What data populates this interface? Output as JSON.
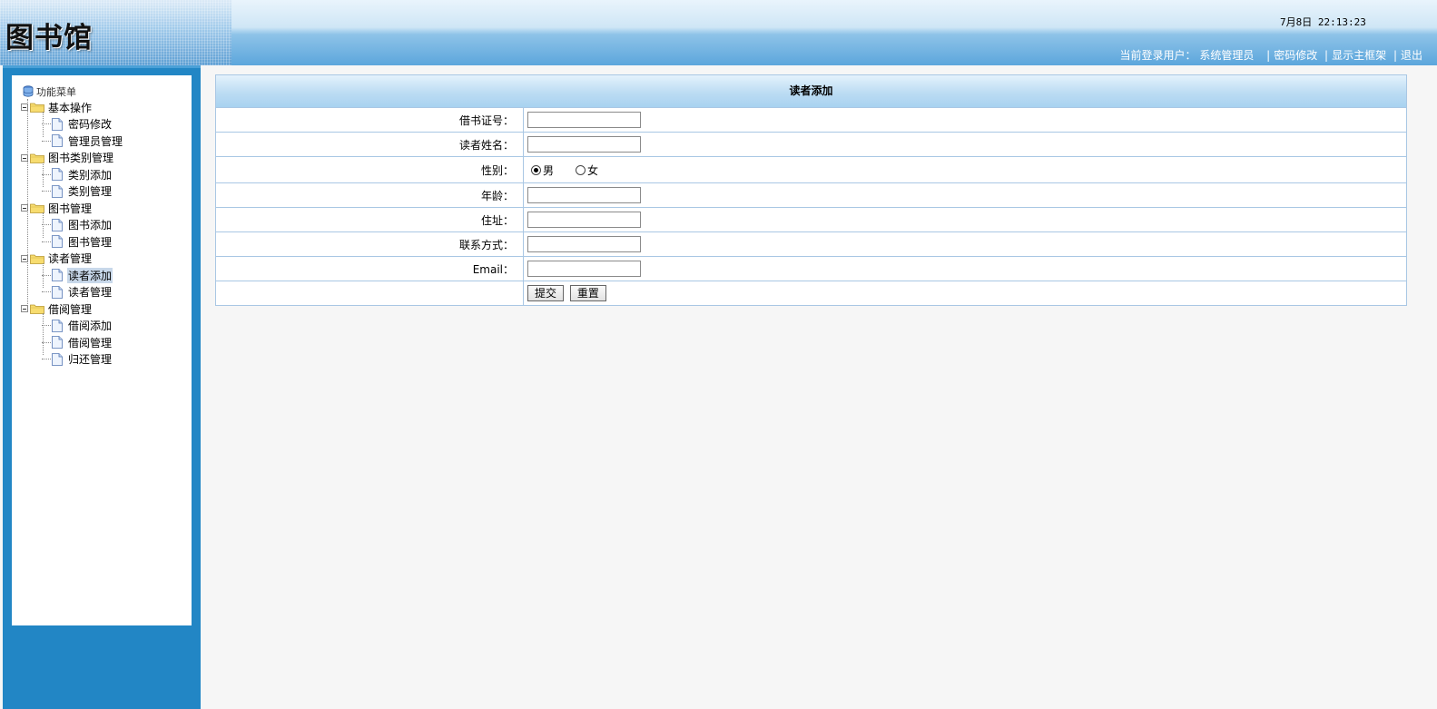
{
  "header": {
    "logo_title": "图书馆",
    "datetime": "7月8日 22:13:23",
    "user_label": "当前登录用户：",
    "user_name": "系统管理员",
    "links": [
      "密码修改",
      "显示主框架",
      "退出"
    ]
  },
  "menu": {
    "root_label": "功能菜单",
    "groups": [
      {
        "label": "基本操作",
        "items": [
          "密码修改",
          "管理员管理"
        ]
      },
      {
        "label": "图书类别管理",
        "items": [
          "类别添加",
          "类别管理"
        ]
      },
      {
        "label": "图书管理",
        "items": [
          "图书添加",
          "图书管理"
        ]
      },
      {
        "label": "读者管理",
        "items": [
          "读者添加",
          "读者管理"
        ]
      },
      {
        "label": "借阅管理",
        "items": [
          "借阅添加",
          "借阅管理",
          "归还管理"
        ]
      }
    ],
    "selected_item": "读者添加"
  },
  "form": {
    "title": "读者添加",
    "fields": {
      "card_no": {
        "label": "借书证号：",
        "value": ""
      },
      "name": {
        "label": "读者姓名：",
        "value": ""
      },
      "gender": {
        "label": "性别：",
        "options": [
          "男",
          "女"
        ],
        "selected": "男"
      },
      "age": {
        "label": "年龄：",
        "value": ""
      },
      "address": {
        "label": "住址：",
        "value": ""
      },
      "contact": {
        "label": "联系方式：",
        "value": ""
      },
      "email": {
        "label": "Email：",
        "value": ""
      }
    },
    "buttons": {
      "submit": "提交",
      "reset": "重置"
    }
  },
  "colors": {
    "sidebar": "#2286c5",
    "header_blue": "#5ca6dc",
    "border": "#a9c7e4",
    "background": "#f6f6f6"
  }
}
